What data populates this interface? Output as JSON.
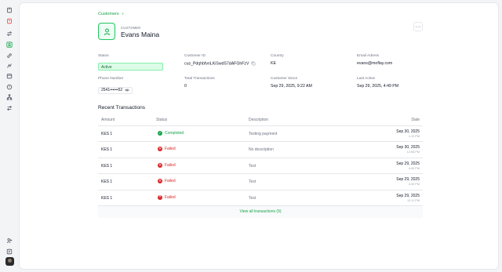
{
  "sidebar": {
    "icons": [
      "book-icon",
      "receipt-icon",
      "transfer-icon",
      "user-icon",
      "link-icon",
      "chart-icon",
      "calendar-icon",
      "box-icon",
      "network-icon",
      "swap-icon"
    ],
    "bottom_icons": [
      "user-plus-icon",
      "help-book-icon"
    ],
    "active": "user-icon",
    "accent": "#16a34a"
  },
  "breadcrumb": {
    "root": "Customers"
  },
  "customer": {
    "kicker": "CUSTOMER",
    "name": "Evans Maina",
    "more_label": "···"
  },
  "details": {
    "status": {
      "label": "Status",
      "value": "Active"
    },
    "customer_id": {
      "label": "Customer ID",
      "value": "cus_PdqhbfvnLKiSwdS7dAFGhFzV"
    },
    "country": {
      "label": "Country",
      "value": "KE"
    },
    "email": {
      "label": "Email Adress",
      "value": "evans@moflay.com"
    },
    "phone": {
      "label": "Phone Number",
      "value": "2541••••••52"
    },
    "total_transactions": {
      "label": "Total Transactions",
      "value": "0"
    },
    "customer_since": {
      "label": "Customer Since",
      "value": "Sep 29, 2025, 9:22 AM"
    },
    "last_active": {
      "label": "Last Active",
      "value": "Sep 29, 2025, 4:49 PM"
    }
  },
  "transactions": {
    "title": "Recent Transactions",
    "columns": {
      "amount": "Amount",
      "status": "Status",
      "description": "Description",
      "date": "Date"
    },
    "rows": [
      {
        "amount": "KES 1",
        "status": "Completed",
        "status_kind": "completed",
        "description": "Testing payment",
        "date": "Sep 30, 2025",
        "time": "1:13 PM"
      },
      {
        "amount": "KES 1",
        "status": "Failed",
        "status_kind": "failed",
        "description": "No description",
        "date": "Sep 30, 2025",
        "time": "12:56 PM"
      },
      {
        "amount": "KES 1",
        "status": "Failed",
        "status_kind": "failed",
        "description": "Test",
        "date": "Sep 29, 2025",
        "time": "4:49 PM"
      },
      {
        "amount": "KES 1",
        "status": "Failed",
        "status_kind": "failed",
        "description": "Test",
        "date": "Sep 29, 2025",
        "time": "4:49 PM"
      },
      {
        "amount": "KES 1",
        "status": "Failed",
        "status_kind": "failed",
        "description": "Test",
        "date": "Sep 29, 2025",
        "time": "12:11 PM"
      }
    ],
    "view_all": "View all transactions (9)"
  }
}
